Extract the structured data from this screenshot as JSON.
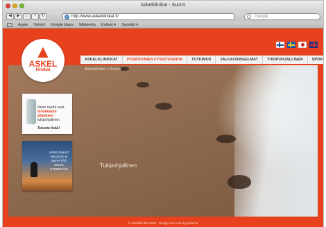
{
  "window": {
    "title": "Askelklinikat - Suomi"
  },
  "toolbar": {
    "url": "http://www.askelklinikat.fi/",
    "search_placeholder": "Google"
  },
  "bookmarks": [
    "Apple",
    "Yahoo!",
    "Google Maps",
    "Wikipedia",
    "Uutiset ▾",
    "Suositut ▾"
  ],
  "logo": {
    "name": "ASKEL",
    "sub": "klinikat",
    "brand_color": "#e8411d"
  },
  "languages": [
    "Suomi",
    "Svenska",
    "日本語",
    "English"
  ],
  "menu": [
    "ASKELKLINIKKAT",
    "POSIITIIVINEN FYSIOTERAPIA",
    "TUTKIMUS",
    "JALKAOSINGELMAT",
    "TUKIPOHJALLINEN",
    "SPORT"
  ],
  "active_menu_index": 1,
  "breadcrumb": "Askelklinikat > Suomi",
  "banner1": {
    "text_a": "Ilman myötä saat,",
    "text_b": "tehokkaasti ylläpitäen",
    "text_c": "tukipohjallinen.",
    "cta": "Tutustu lisää!"
  },
  "banner2": {
    "text": "ASKELINIKAT NEUVOO & KEHITTÄÄ SINUA ETEENPÄIN"
  },
  "caption": "Tukipohjallinen",
  "footer": "© Askelklinikat 2010  ·  Design and code by Millenia"
}
